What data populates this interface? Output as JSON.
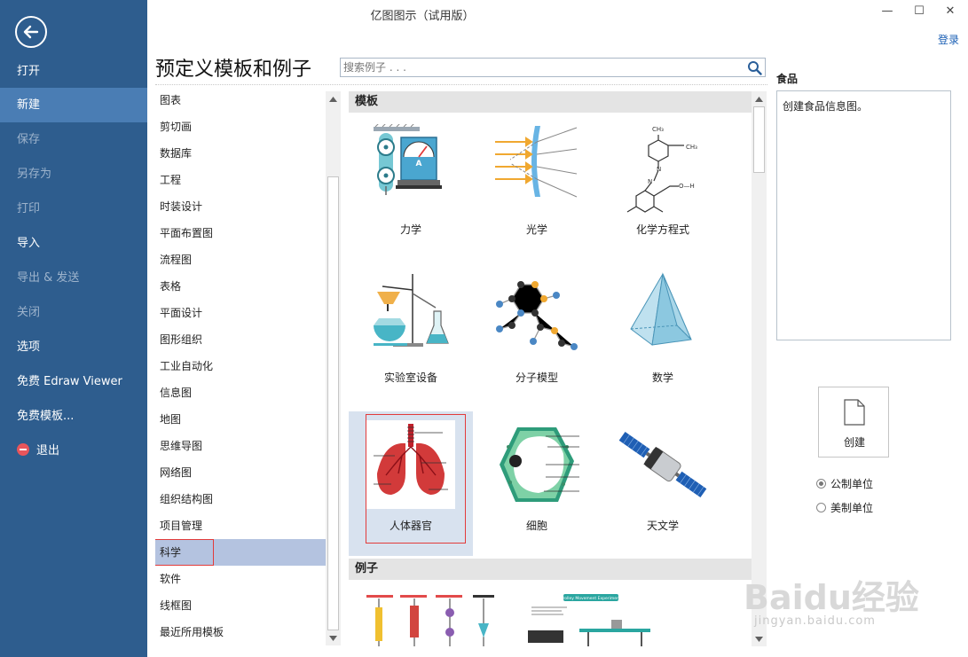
{
  "window": {
    "title": "亿图图示（试用版）",
    "minimize": "—",
    "maximize": "☐",
    "close": "✕",
    "login": "登录"
  },
  "sidebar": {
    "items": [
      {
        "label": "打开",
        "state": "normal"
      },
      {
        "label": "新建",
        "state": "active"
      },
      {
        "label": "保存",
        "state": "disabled"
      },
      {
        "label": "另存为",
        "state": "disabled"
      },
      {
        "label": "打印",
        "state": "disabled"
      },
      {
        "label": "导入",
        "state": "normal"
      },
      {
        "label": "导出 & 发送",
        "state": "disabled"
      },
      {
        "label": "关闭",
        "state": "disabled"
      },
      {
        "label": "选项",
        "state": "normal"
      },
      {
        "label": "免费 Edraw Viewer",
        "state": "normal"
      },
      {
        "label": "免费模板...",
        "state": "normal"
      },
      {
        "label": "退出",
        "state": "normal"
      }
    ]
  },
  "main": {
    "page_title": "预定义模板和例子",
    "search": {
      "placeholder": "搜索例子 . . .",
      "value": ""
    }
  },
  "categories": [
    "图表",
    "剪切画",
    "数据库",
    "工程",
    "时装设计",
    "平面布置图",
    "流程图",
    "表格",
    "平面设计",
    "图形组织",
    "工业自动化",
    "信息图",
    "地图",
    "思维导图",
    "网络图",
    "组织结构图",
    "项目管理",
    "科学",
    "软件",
    "线框图",
    "最近所用模板"
  ],
  "selected_category": "科学",
  "templates": {
    "section_label": "模板",
    "items": [
      {
        "label": "力学",
        "icon": "mechanics-thumbnail"
      },
      {
        "label": "光学",
        "icon": "optics-thumbnail"
      },
      {
        "label": "化学方程式",
        "icon": "chemical-equation-thumbnail"
      },
      {
        "label": "实验室设备",
        "icon": "lab-equipment-thumbnail"
      },
      {
        "label": "分子模型",
        "icon": "molecular-model-thumbnail"
      },
      {
        "label": "数学",
        "icon": "math-pyramid-thumbnail"
      },
      {
        "label": "人体器官",
        "icon": "human-lungs-thumbnail"
      },
      {
        "label": "细胞",
        "icon": "cell-thumbnail"
      },
      {
        "label": "天文学",
        "icon": "satellite-thumbnail"
      }
    ],
    "selected": "人体器官"
  },
  "examples": {
    "section_label": "例子"
  },
  "thumb_text": {
    "meter_a": "A",
    "ch3": "CH₃",
    "n": "N",
    "oh": "O—H",
    "example_banner": "Trolley Movement Experiment"
  },
  "description": {
    "title": "食品",
    "text": "创建食品信息图。"
  },
  "create": {
    "label": "创建"
  },
  "units": {
    "options": [
      "公制单位",
      "美制单位"
    ],
    "selected": "公制单位"
  },
  "watermark": {
    "text": "Baidu经验",
    "url": "jingyan.baidu.com"
  },
  "colors": {
    "sidebar_bg": "#2e5d8e",
    "sidebar_active": "#4a7db4",
    "category_selected": "#b4c3e0",
    "highlight_box": "#e23b3b",
    "link": "#1a5fb4"
  }
}
